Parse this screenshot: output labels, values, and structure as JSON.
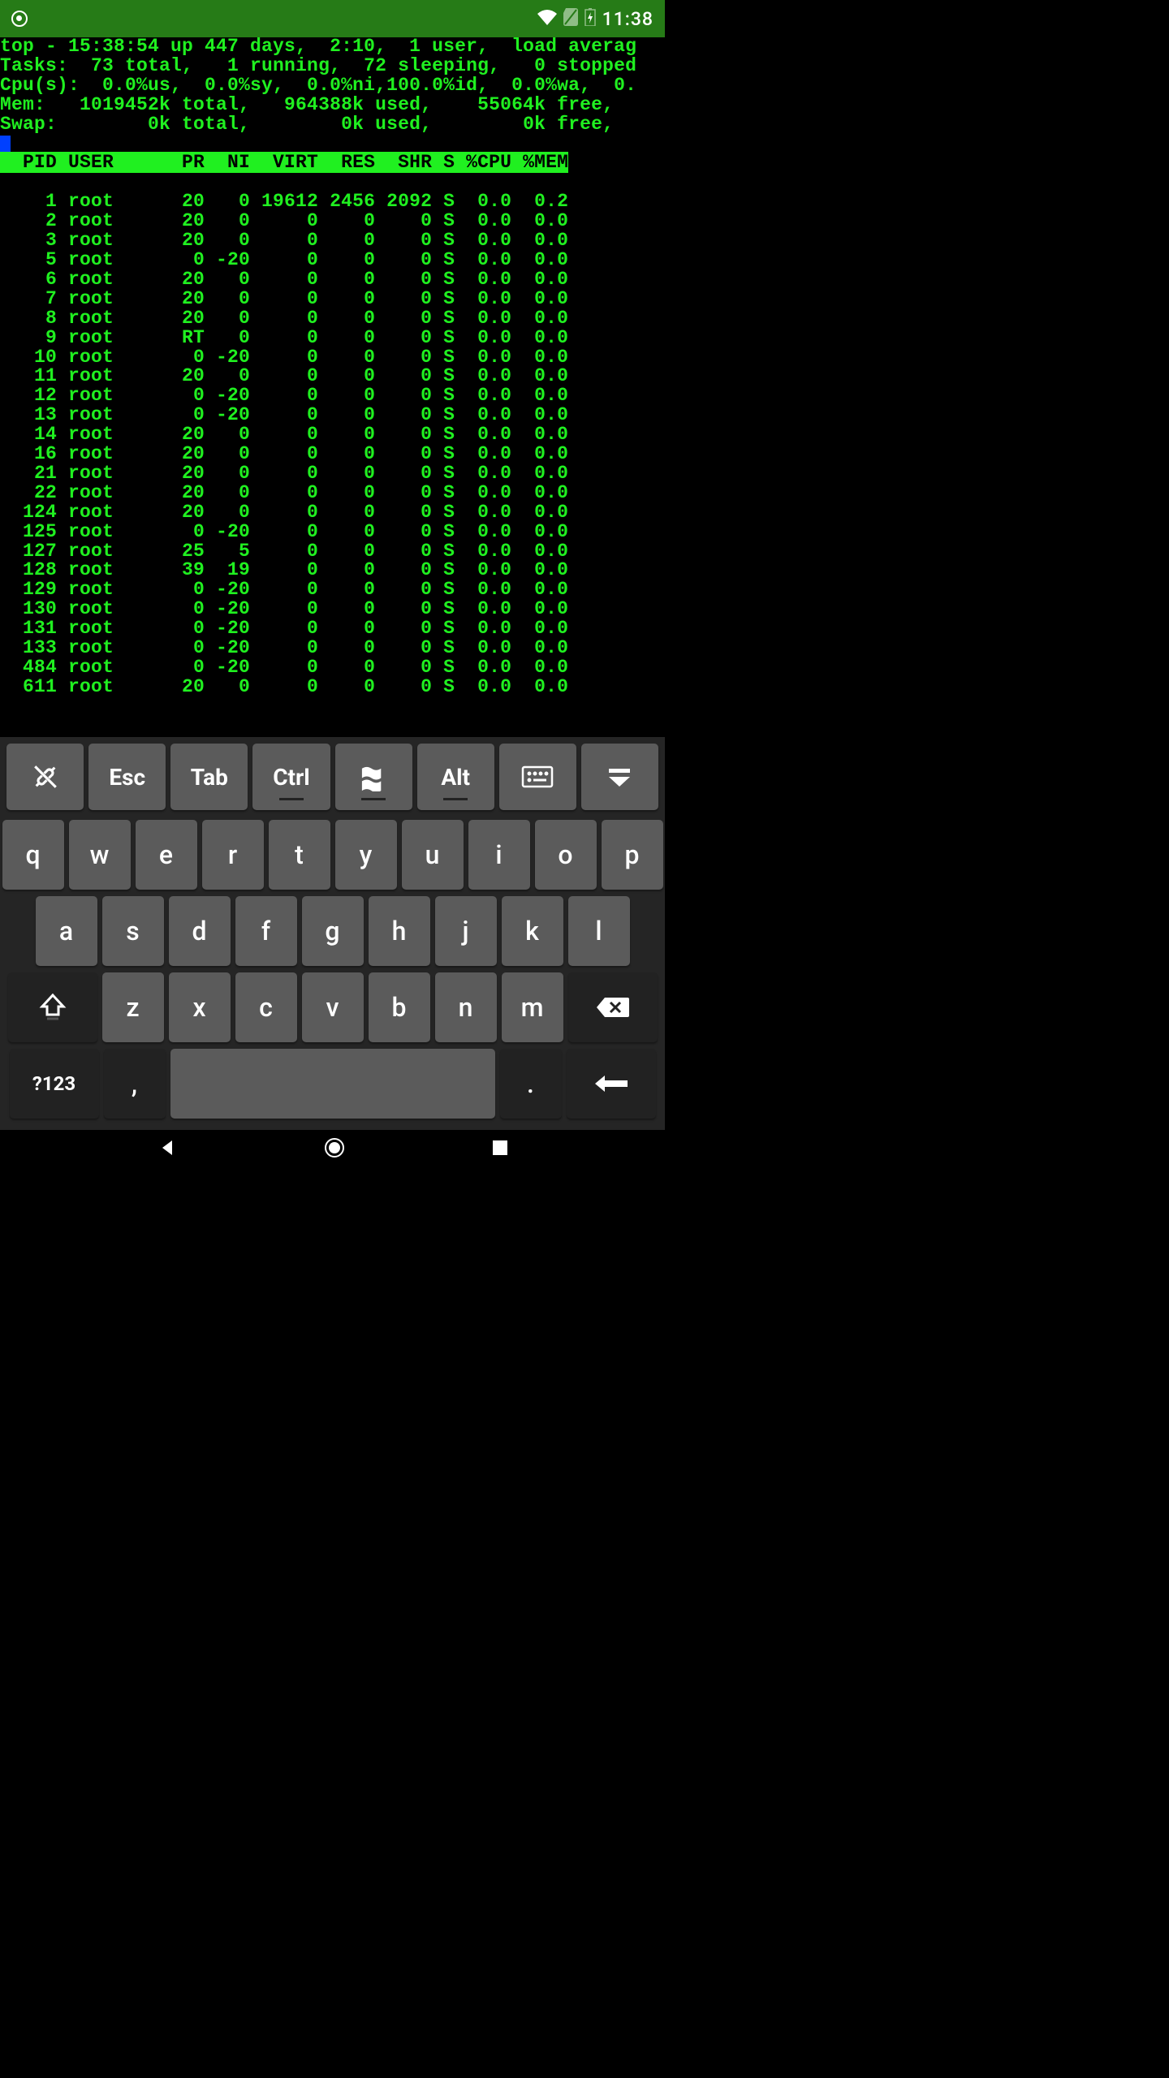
{
  "status": {
    "time": "11:38"
  },
  "term": {
    "line1": "top - 15:38:54 up 447 days,  2:10,  1 user,  load averag",
    "line2": "Tasks:  73 total,   1 running,  72 sleeping,   0 stopped",
    "line3": "Cpu(s):  0.0%us,  0.0%sy,  0.0%ni,100.0%id,  0.0%wa,  0.",
    "line4": "Mem:   1019452k total,   964388k used,    55064k free,  ",
    "line5": "Swap:        0k total,        0k used,        0k free,  ",
    "header": "  PID USER      PR  NI  VIRT  RES  SHR S %CPU %MEM",
    "rows": [
      "    1 root      20   0 19612 2456 2092 S  0.0  0.2",
      "    2 root      20   0     0    0    0 S  0.0  0.0",
      "    3 root      20   0     0    0    0 S  0.0  0.0",
      "    5 root       0 -20     0    0    0 S  0.0  0.0",
      "    6 root      20   0     0    0    0 S  0.0  0.0",
      "    7 root      20   0     0    0    0 S  0.0  0.0",
      "    8 root      20   0     0    0    0 S  0.0  0.0",
      "    9 root      RT   0     0    0    0 S  0.0  0.0",
      "   10 root       0 -20     0    0    0 S  0.0  0.0",
      "   11 root      20   0     0    0    0 S  0.0  0.0",
      "   12 root       0 -20     0    0    0 S  0.0  0.0",
      "   13 root       0 -20     0    0    0 S  0.0  0.0",
      "   14 root      20   0     0    0    0 S  0.0  0.0",
      "   16 root      20   0     0    0    0 S  0.0  0.0",
      "   21 root      20   0     0    0    0 S  0.0  0.0",
      "   22 root      20   0     0    0    0 S  0.0  0.0",
      "  124 root      20   0     0    0    0 S  0.0  0.0",
      "  125 root       0 -20     0    0    0 S  0.0  0.0",
      "  127 root      25   5     0    0    0 S  0.0  0.0",
      "  128 root      39  19     0    0    0 S  0.0  0.0",
      "  129 root       0 -20     0    0    0 S  0.0  0.0",
      "  130 root       0 -20     0    0    0 S  0.0  0.0",
      "  131 root       0 -20     0    0    0 S  0.0  0.0",
      "  133 root       0 -20     0    0    0 S  0.0  0.0",
      "  484 root       0 -20     0    0    0 S  0.0  0.0",
      "  611 root      20   0     0    0    0 S  0.0  0.0"
    ]
  },
  "toolbar": {
    "k1": "Esc",
    "k2": "Tab",
    "k3": "Ctrl",
    "k4": "Alt"
  },
  "kb": {
    "r1": [
      "q",
      "w",
      "e",
      "r",
      "t",
      "y",
      "u",
      "i",
      "o",
      "p"
    ],
    "r2": [
      "a",
      "s",
      "d",
      "f",
      "g",
      "h",
      "j",
      "k",
      "l"
    ],
    "r3": [
      "z",
      "x",
      "c",
      "v",
      "b",
      "n",
      "m"
    ],
    "sym": "?123",
    "comma": ",",
    "period": "."
  }
}
